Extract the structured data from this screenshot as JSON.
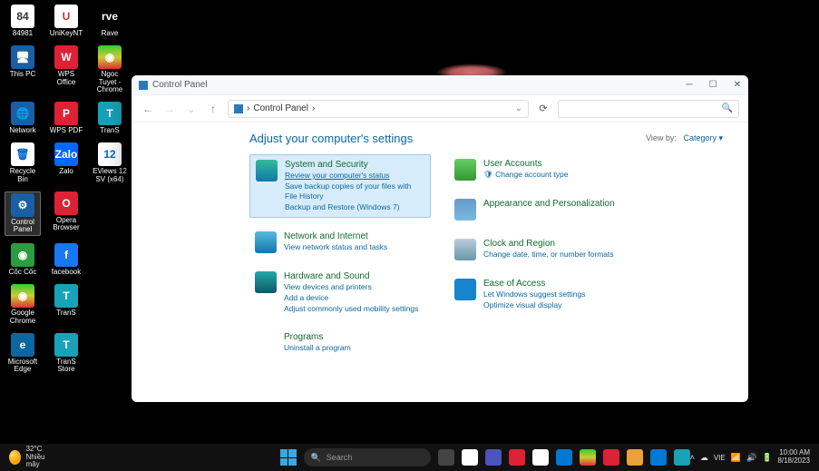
{
  "desktop_icons": [
    [
      {
        "lbl": "84981",
        "bg": "#fff",
        "tc": "#333",
        "g": "84"
      },
      {
        "lbl": "UniKeyNT",
        "bg": "#fff",
        "tc": "#c33",
        "g": "U"
      },
      {
        "lbl": "Rave",
        "bg": "#000",
        "tc": "#fff",
        "g": "rve"
      }
    ],
    [
      {
        "lbl": "This PC",
        "bg": "#1a5fa3",
        "tc": "#fff",
        "g": "🖥"
      },
      {
        "lbl": "WPS Office",
        "bg": "#d23",
        "tc": "#fff",
        "g": "W"
      },
      {
        "lbl": "Ngoc Tuyet - Chrome",
        "bg": "linear-gradient(#3c3,#cc3,#d33)",
        "tc": "#fff",
        "g": "◉"
      }
    ],
    [
      {
        "lbl": "Network",
        "bg": "#1a5fa3",
        "tc": "#fff",
        "g": "🌐"
      },
      {
        "lbl": "WPS PDF",
        "bg": "#d23",
        "tc": "#fff",
        "g": "P"
      },
      {
        "lbl": "TranS",
        "bg": "#17a2b8",
        "tc": "#fff",
        "g": "T"
      }
    ],
    [
      {
        "lbl": "Recycle Bin",
        "bg": "#fff",
        "tc": "#06c",
        "g": "🗑"
      },
      {
        "lbl": "Zalo",
        "bg": "#0068ff",
        "tc": "#fff",
        "g": "Zalo"
      },
      {
        "lbl": "EViews 12 SV (x64)",
        "bg": "#fff",
        "tc": "#06c",
        "g": "12"
      }
    ],
    [
      {
        "lbl": "Control Panel",
        "bg": "#1a5fa3",
        "tc": "#fff",
        "g": "⚙",
        "sel": true
      },
      {
        "lbl": "Opera Browser",
        "bg": "#d23",
        "tc": "#fff",
        "g": "O"
      }
    ],
    [
      {
        "lbl": "Cốc Cốc",
        "bg": "#2a9d3f",
        "tc": "#fff",
        "g": "◉"
      },
      {
        "lbl": "facebook",
        "bg": "#1877f2",
        "tc": "#fff",
        "g": "f"
      }
    ],
    [
      {
        "lbl": "Google Chrome",
        "bg": "linear-gradient(#3c3,#cc3,#d33)",
        "tc": "#fff",
        "g": "◉"
      },
      {
        "lbl": "TranS",
        "bg": "#17a2b8",
        "tc": "#fff",
        "g": "T"
      }
    ],
    [
      {
        "lbl": "Microsoft Edge",
        "bg": "#0b67a0",
        "tc": "#fff",
        "g": "e"
      },
      {
        "lbl": "TranS Store",
        "bg": "#17a2b8",
        "tc": "#fff",
        "g": "T"
      }
    ]
  ],
  "window": {
    "title": "Control Panel",
    "address": "Control Panel",
    "address_sep": "›",
    "heading": "Adjust your computer's settings",
    "viewby_label": "View by:",
    "viewby_value": "Category ▾"
  },
  "cats_left": [
    {
      "title": "System and Security",
      "hl": true,
      "bg": "linear-gradient(#3b9,#17a)",
      "links": [
        "Review your computer's status",
        "Save backup copies of your files with File History",
        "Backup and Restore (Windows 7)"
      ]
    },
    {
      "title": "Network and Internet",
      "bg": "linear-gradient(#5bd,#17a)",
      "links": [
        "View network status and tasks"
      ]
    },
    {
      "title": "Hardware and Sound",
      "bg": "linear-gradient(#2aa,#156)",
      "links": [
        "View devices and printers",
        "Add a device",
        "Adjust commonly used mobility settings"
      ]
    },
    {
      "title": "Programs",
      "bg": "#fff",
      "links": [
        "Uninstall a program"
      ]
    }
  ],
  "cats_right": [
    {
      "title": "User Accounts",
      "bg": "linear-gradient(#6c6,#393)",
      "links": [
        "Change account type"
      ],
      "shield": true
    },
    {
      "title": "Appearance and Personalization",
      "bg": "linear-gradient(#69c,#7bd)",
      "links": []
    },
    {
      "title": "Clock and Region",
      "bg": "linear-gradient(#bcd,#69a)",
      "links": [
        "Change date, time, or number formats"
      ]
    },
    {
      "title": "Ease of Access",
      "bg": "#1784d0",
      "links": [
        "Let Windows suggest settings",
        "Optimize visual display"
      ]
    }
  ],
  "taskbar": {
    "weather_temp": "32°C",
    "weather_desc": "Nhiều mây",
    "search_label": "Search",
    "apps": [
      {
        "bg": "#444"
      },
      {
        "bg": "#fff"
      },
      {
        "bg": "#4b53bc"
      },
      {
        "bg": "#d23"
      },
      {
        "bg": "#fff"
      },
      {
        "bg": "#0078d4"
      },
      {
        "bg": "linear-gradient(#3c3,#cc3,#d33)"
      },
      {
        "bg": "#d23"
      },
      {
        "bg": "#e9a23b"
      },
      {
        "bg": "#0078d4"
      },
      {
        "bg": "#17a2b8"
      }
    ],
    "lang": "VIE",
    "time": "10:00 AM",
    "date": "8/18/2023"
  }
}
